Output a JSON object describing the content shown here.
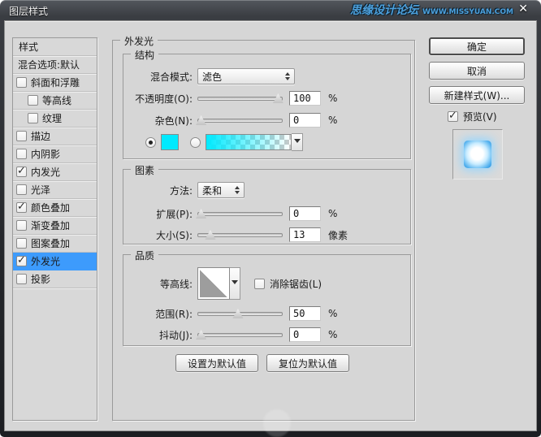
{
  "window": {
    "title": "图层样式",
    "close_glyph": "✕",
    "brand": "思缘设计论坛",
    "brand_url": "WWW.MISSYUAN.COM"
  },
  "sidebar": {
    "header": "样式",
    "blending_default": "混合选项:默认",
    "items": [
      {
        "label": "斜面和浮雕",
        "checked": false,
        "selected": false
      },
      {
        "label": "等高线",
        "checked": false,
        "selected": false
      },
      {
        "label": "纹理",
        "checked": false,
        "selected": false
      },
      {
        "label": "描边",
        "checked": false,
        "selected": false
      },
      {
        "label": "内阴影",
        "checked": false,
        "selected": false
      },
      {
        "label": "内发光",
        "checked": true,
        "selected": false
      },
      {
        "label": "光泽",
        "checked": false,
        "selected": false
      },
      {
        "label": "颜色叠加",
        "checked": true,
        "selected": false
      },
      {
        "label": "渐变叠加",
        "checked": false,
        "selected": false
      },
      {
        "label": "图案叠加",
        "checked": false,
        "selected": false
      },
      {
        "label": "外发光",
        "checked": true,
        "selected": true
      },
      {
        "label": "投影",
        "checked": false,
        "selected": false
      }
    ]
  },
  "panel": {
    "title": "外发光",
    "structure": {
      "title": "结构",
      "blend_mode_label": "混合模式:",
      "blend_mode_value": "滤色",
      "opacity_label": "不透明度(O):",
      "opacity_value": "100",
      "opacity_unit": "%",
      "noise_label": "杂色(N):",
      "noise_value": "0",
      "noise_unit": "%",
      "glow_color": "#00eaff"
    },
    "elements": {
      "title": "图素",
      "technique_label": "方法:",
      "technique_value": "柔和",
      "spread_label": "扩展(P):",
      "spread_value": "0",
      "spread_unit": "%",
      "size_label": "大小(S):",
      "size_value": "13",
      "size_unit": "像素"
    },
    "quality": {
      "title": "品质",
      "contour_label": "等高线:",
      "antialias_label": "消除锯齿(L)",
      "range_label": "范围(R):",
      "range_value": "50",
      "range_unit": "%",
      "jitter_label": "抖动(J):",
      "jitter_value": "0",
      "jitter_unit": "%"
    },
    "sliders": {
      "opacity": 96,
      "noise": 4,
      "spread": 4,
      "size": 15,
      "range": 48,
      "jitter": 4
    },
    "make_default_label": "设置为默认值",
    "reset_default_label": "复位为默认值"
  },
  "actions": {
    "ok": "确定",
    "cancel": "取消",
    "new_style": "新建样式(W)...",
    "preview": "预览(V)",
    "preview_checked": true
  },
  "colors": {
    "selection_highlight": "#3d9bfc",
    "glow_cyan": "#00eaff",
    "brand_blue": "#4da0dc"
  }
}
